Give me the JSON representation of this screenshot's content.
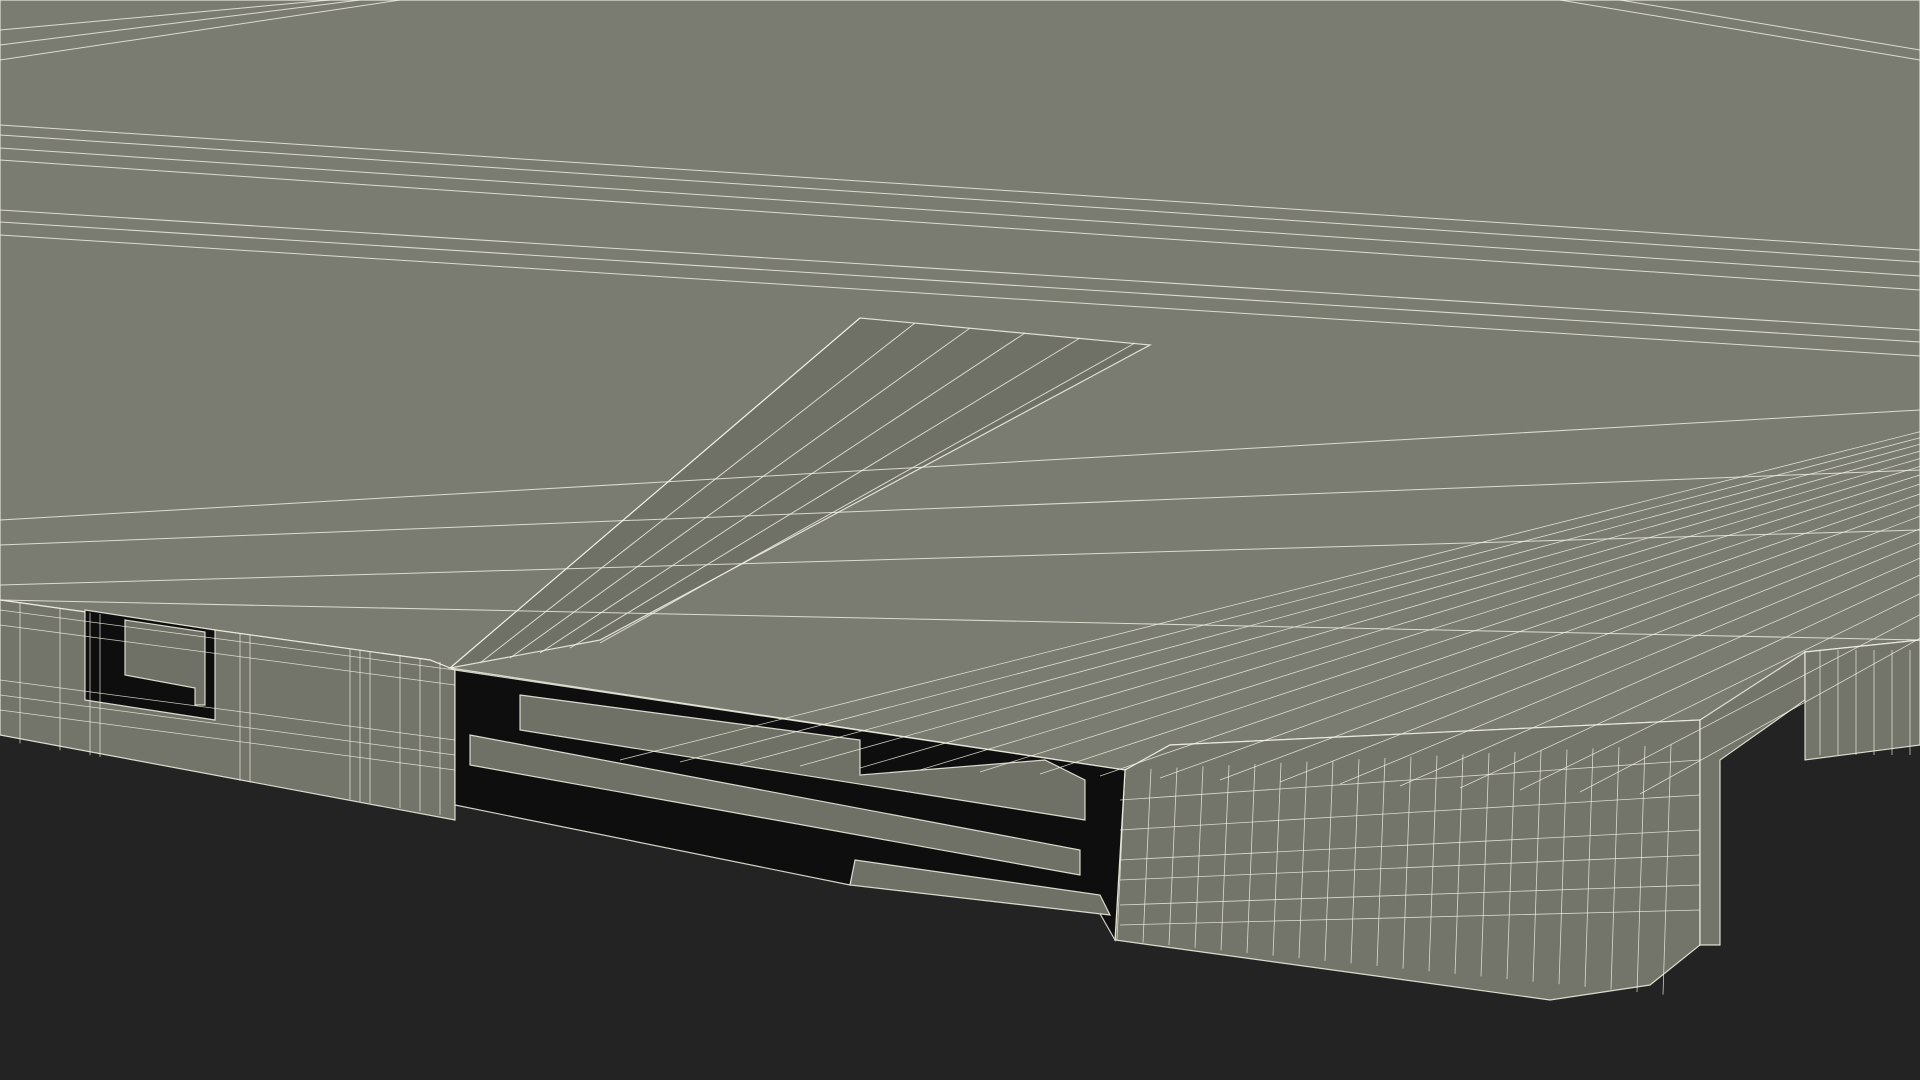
{
  "scene": {
    "subject": "wireframe-render-of-slotted-plate",
    "colors": {
      "background": "#232323",
      "surface_top": "#7b7c71",
      "surface_side": "#74756a",
      "surface_inner": "#6f7066",
      "slot_shadow": "#0e0e0e",
      "wire": "#f4f3e6"
    }
  }
}
